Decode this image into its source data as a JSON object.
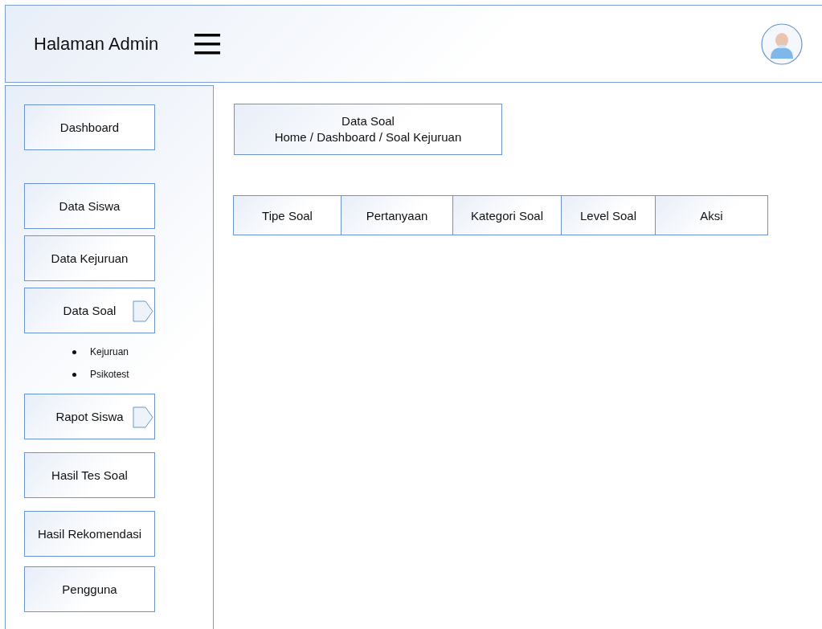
{
  "header": {
    "title": "Halaman Admin"
  },
  "sidebar": {
    "items": [
      {
        "label": "Dashboard",
        "expandable": false
      },
      {
        "label": "Data Siswa",
        "expandable": false
      },
      {
        "label": "Data Kejuruan",
        "expandable": false
      },
      {
        "label": "Data Soal",
        "expandable": true,
        "children": [
          {
            "label": "Kejuruan"
          },
          {
            "label": "Psikotest"
          }
        ]
      },
      {
        "label": "Rapot Siswa",
        "expandable": true
      },
      {
        "label": "Hasil Tes Soal",
        "expandable": false
      },
      {
        "label": "Hasil Rekomendasi",
        "expandable": false
      },
      {
        "label": "Pengguna",
        "expandable": false
      }
    ]
  },
  "page_heading": {
    "title": "Data Soal",
    "breadcrumb": "Home / Dashboard / Soal Kejuruan"
  },
  "table": {
    "columns": [
      "Tipe Soal",
      "Pertanyaan",
      "Kategori Soal",
      "Level Soal",
      "Aksi"
    ]
  }
}
